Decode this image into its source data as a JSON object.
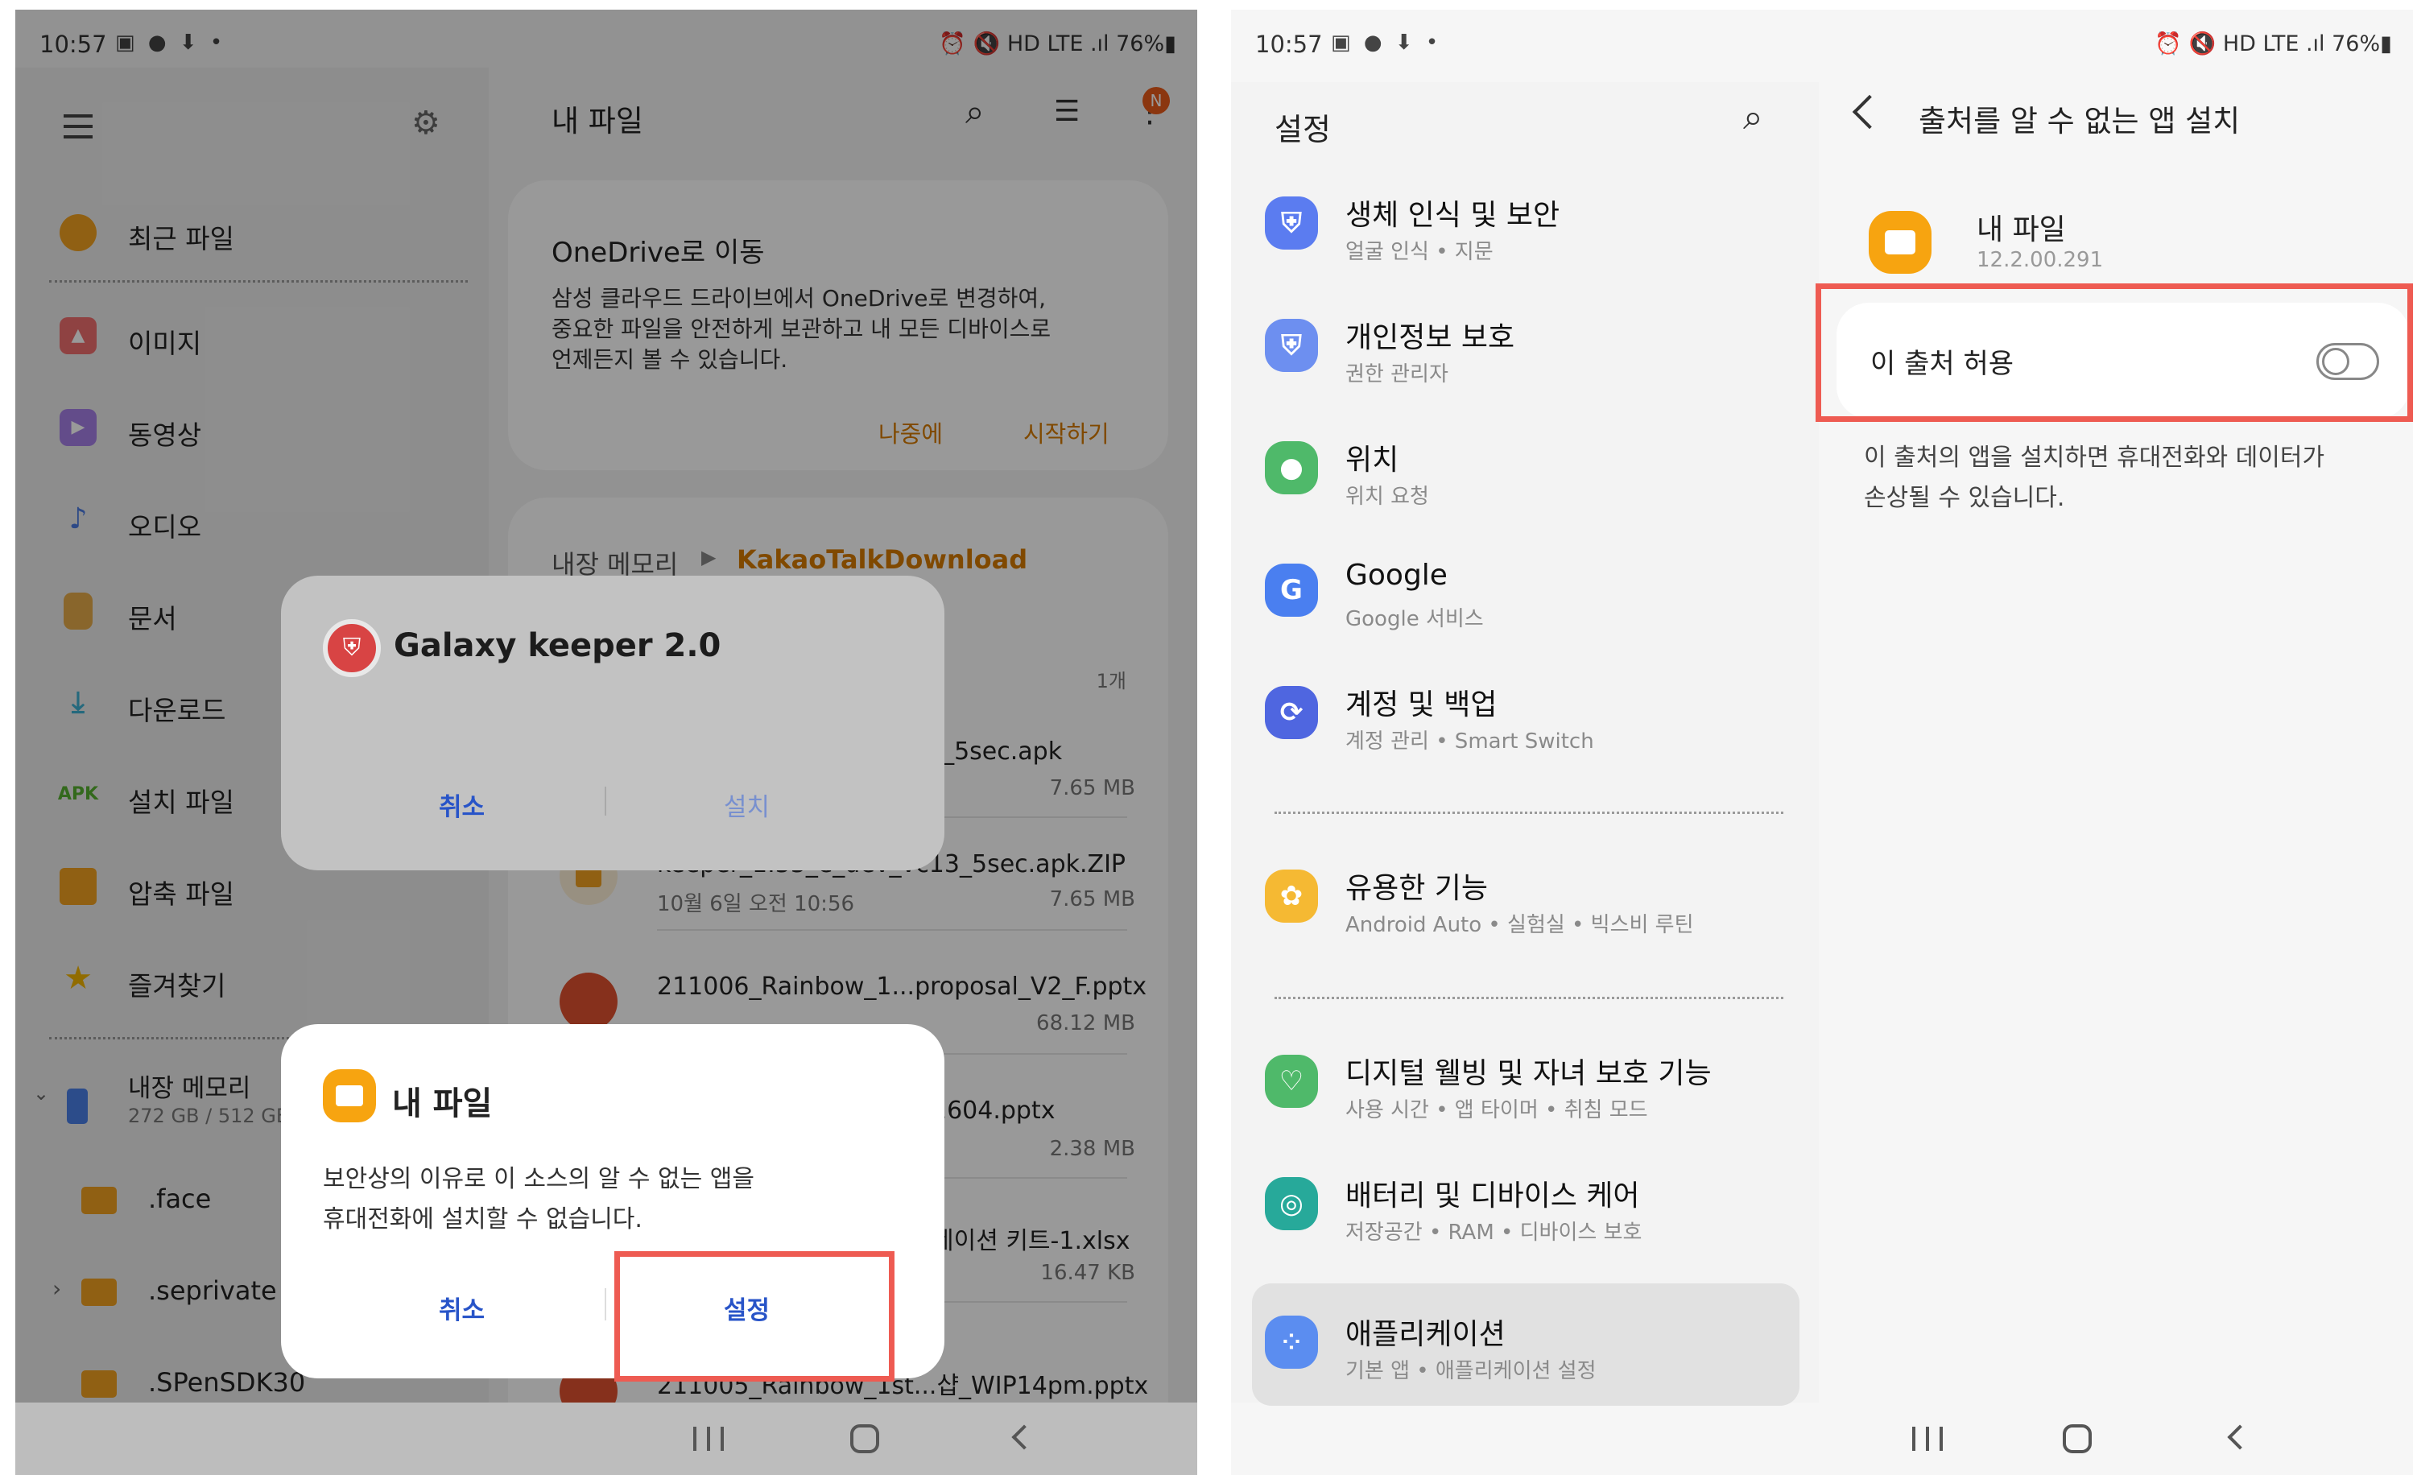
{
  "left": {
    "status": {
      "time": "10:57",
      "right": "⏰ 🔇 HD LTE .ıl 76%▮"
    },
    "app_bar": {
      "title": "내 파일",
      "badge": "N"
    },
    "drawer": {
      "recent": "최근 파일",
      "items": [
        "이미지",
        "동영상",
        "오디오",
        "문서",
        "다운로드",
        "설치 파일",
        "압축 파일",
        "즐겨찾기"
      ],
      "apk_tag": "APK",
      "storage_name": "내장 메모리",
      "storage_usage": "272 GB / 512 GB",
      "folders": [
        ".face",
        ".seprivate",
        ".SPenSDK30"
      ]
    },
    "onedrive_card": {
      "title": "OneDrive로 이동",
      "body_lines": [
        "삼성 클라우드 드라이브에서 OneDrive로 변경하여,",
        "중요한 파일을 안전하게 보관하고 내 모든 디바이스로",
        "언제든지 볼 수 있습니다."
      ],
      "later": "나중에",
      "start": "시작하기"
    },
    "path": {
      "root": "내장 메모리",
      "current": "KakaoTalkDownload"
    },
    "count": "1개",
    "files": [
      {
        "name": "3_5sec.apk",
        "date": "",
        "size": "7.65 MB"
      },
      {
        "name": "keeper_1.33_e_dev_vc13_5sec.apk.ZIP",
        "date": "10월 6일 오전 10:56",
        "size": "7.65 MB"
      },
      {
        "name": "211006_Rainbow_1...proposal_V2_F.pptx",
        "date": "",
        "size": "68.12 MB"
      },
      {
        "name": "1604.pptx",
        "date": "",
        "size": "2.38 MB"
      },
      {
        "name": "네이션 키트-1.xlsx",
        "date": "",
        "size": "16.47 KB"
      },
      {
        "name": "211005_Rainbow_1st...샵_WIP14pm.pptx",
        "date": "",
        "size": ""
      }
    ],
    "install_dialog": {
      "title": "Galaxy keeper 2.0",
      "cancel": "취소",
      "install": "설치"
    },
    "security_dialog": {
      "title": "내 파일",
      "body_lines": [
        "보안상의 이유로 이 소스의 알 수 없는 앱을",
        "휴대전화에 설치할 수 없습니다."
      ],
      "cancel": "취소",
      "settings": "설정"
    }
  },
  "right": {
    "status": {
      "time": "10:57",
      "right": "⏰ 🔇 HD LTE .ıl 76%▮"
    },
    "settings": {
      "title": "설정",
      "items": [
        {
          "title": "생체 인식 및 보안",
          "subtitle": "얼굴 인식 • 지문",
          "icon": "shield-icon",
          "color": "#5b7cf0"
        },
        {
          "title": "개인정보 보호",
          "subtitle": "권한 관리자",
          "icon": "privacy-icon",
          "color": "#6d8ff0"
        },
        {
          "title": "위치",
          "subtitle": "위치 요청",
          "icon": "location-icon",
          "color": "#4fb96a"
        },
        {
          "title": "Google",
          "subtitle": "Google 서비스",
          "icon": "google-icon",
          "color": "#4a7ff0"
        },
        {
          "title": "계정 및 백업",
          "subtitle": "계정 관리 • Smart Switch",
          "icon": "sync-icon",
          "color": "#4f66e0"
        },
        {
          "title": "유용한 기능",
          "subtitle": "Android Auto • 실험실 • 빅스비 루틴",
          "icon": "star-gear-icon",
          "color": "#f5b933"
        },
        {
          "title": "디지털 웰빙 및 자녀 보호 기능",
          "subtitle": "사용 시간 • 앱 타이머 • 취침 모드",
          "icon": "wellbeing-icon",
          "color": "#4fb96a"
        },
        {
          "title": "배터리 및 디바이스 케어",
          "subtitle": "저장공간 • RAM • 디바이스 보호",
          "icon": "device-care-icon",
          "color": "#27a99a"
        },
        {
          "title": "애플리케이션",
          "subtitle": "기본 앱 • 애플리케이션 설정",
          "icon": "apps-icon",
          "color": "#5b8df0"
        }
      ]
    },
    "unknown_apps": {
      "title": "출처를 알 수 없는 앱 설치",
      "app_name": "내 파일",
      "app_version": "12.2.00.291",
      "toggle_label": "이 출처 허용",
      "toggle_on": false,
      "warning_lines": [
        "이 출처의 앱을 설치하면 휴대전화와 데이터가",
        "손상될 수 있습니다."
      ]
    }
  },
  "colors": {
    "accent_orange": "#d67a00",
    "accent_blue": "#2f5fd6",
    "highlight": "#ee5b52",
    "myfiles_yellow": "#f7a410"
  }
}
